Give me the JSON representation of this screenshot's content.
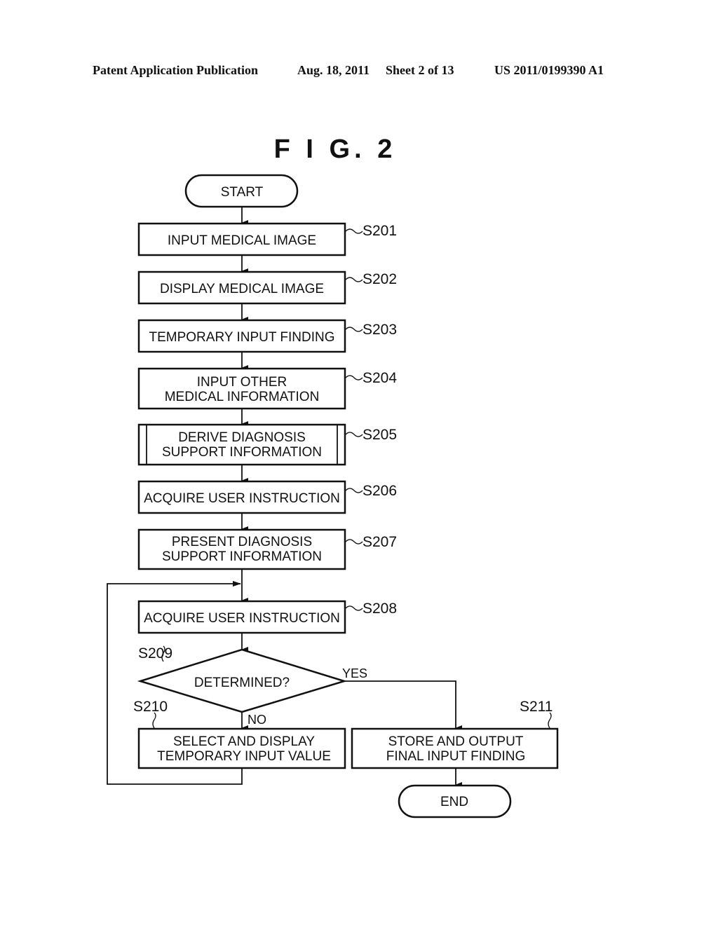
{
  "header": {
    "publication": "Patent Application Publication",
    "date": "Aug. 18, 2011",
    "sheet": "Sheet 2 of 13",
    "number": "US 2011/0199390 A1"
  },
  "figure": {
    "title": "F I G. 2"
  },
  "flowchart": {
    "start": "START",
    "end": "END",
    "steps": [
      {
        "id": "S201",
        "lines": [
          "INPUT MEDICAL IMAGE"
        ]
      },
      {
        "id": "S202",
        "lines": [
          "DISPLAY MEDICAL IMAGE"
        ]
      },
      {
        "id": "S203",
        "lines": [
          "TEMPORARY INPUT FINDING"
        ]
      },
      {
        "id": "S204",
        "lines": [
          "INPUT OTHER",
          "MEDICAL INFORMATION"
        ]
      },
      {
        "id": "S205",
        "lines": [
          "DERIVE DIAGNOSIS",
          "SUPPORT INFORMATION"
        ],
        "type": "predefined-process"
      },
      {
        "id": "S206",
        "lines": [
          "ACQUIRE USER INSTRUCTION"
        ]
      },
      {
        "id": "S207",
        "lines": [
          "PRESENT DIAGNOSIS",
          "SUPPORT INFORMATION"
        ]
      },
      {
        "id": "S208",
        "lines": [
          "ACQUIRE USER INSTRUCTION"
        ]
      },
      {
        "id": "S209",
        "lines": [
          "DETERMINED?"
        ],
        "type": "decision"
      },
      {
        "id": "S210",
        "lines": [
          "SELECT AND DISPLAY",
          "TEMPORARY INPUT VALUE"
        ]
      },
      {
        "id": "S211",
        "lines": [
          "STORE AND OUTPUT",
          "FINAL INPUT FINDING"
        ]
      }
    ],
    "branches": {
      "yes": "YES",
      "no": "NO"
    }
  }
}
